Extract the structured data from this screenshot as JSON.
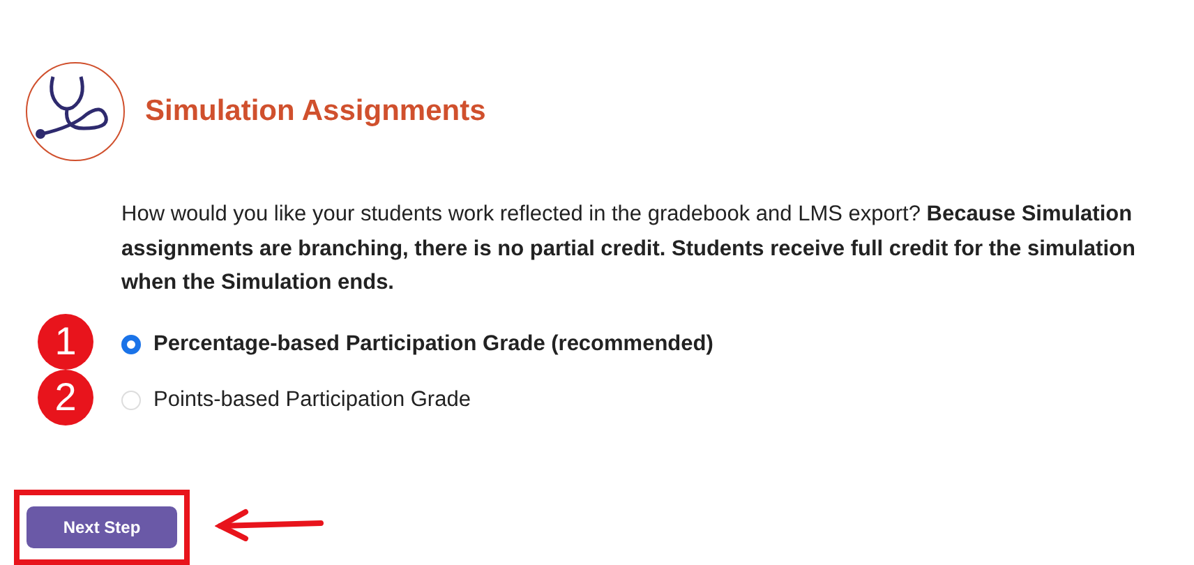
{
  "header": {
    "title": "Simulation Assignments"
  },
  "intro": "How would you like your students work reflected in the gradebook and LMS export? **Because Simulation assignments are branching, there is no partial credit. Students receive full credit for the simulation when the Simulation ends.**",
  "options": [
    {
      "label": "Percentage-based Participation Grade (recommended)",
      "selected": true,
      "marker": "1"
    },
    {
      "label": "Points-based Participation Grade",
      "selected": false,
      "marker": "2"
    }
  ],
  "button": {
    "label": "Next Step",
    "highlighted": true
  }
}
